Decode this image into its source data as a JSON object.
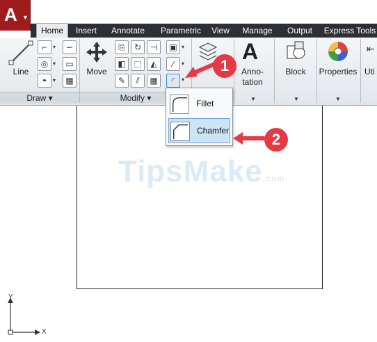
{
  "app": {
    "logo_letter": "A"
  },
  "tabs": [
    {
      "label": "Home",
      "active": true
    },
    {
      "label": "Insert"
    },
    {
      "label": "Annotate"
    },
    {
      "label": "Parametric"
    },
    {
      "label": "View"
    },
    {
      "label": "Manage"
    },
    {
      "label": "Output"
    },
    {
      "label": "Express Tools"
    }
  ],
  "ribbon": {
    "draw": {
      "line_label": "Line",
      "panel_title": "Draw ▾"
    },
    "modify": {
      "move_label": "Move",
      "panel_title": "Modify ▾"
    },
    "annotation": {
      "label_line1": "Anno-",
      "label_line2": "tation"
    },
    "block": {
      "label": "Block"
    },
    "properties": {
      "label": "Properties"
    },
    "utilities": {
      "label": "Uti"
    }
  },
  "fillet_menu": {
    "items": [
      {
        "label": "Fillet"
      },
      {
        "label": "Chamfer",
        "selected": true
      }
    ]
  },
  "callouts": [
    "1",
    "2"
  ],
  "watermark": {
    "main": "TipsMake",
    "suffix": ".com"
  },
  "ucs": {
    "x_label": "X",
    "y_label": "Y"
  },
  "colors": {
    "accent": "#e63946",
    "tab_bar": "#2c2f33",
    "app_button": "#a01c1c",
    "selection": "#cde4f7"
  }
}
